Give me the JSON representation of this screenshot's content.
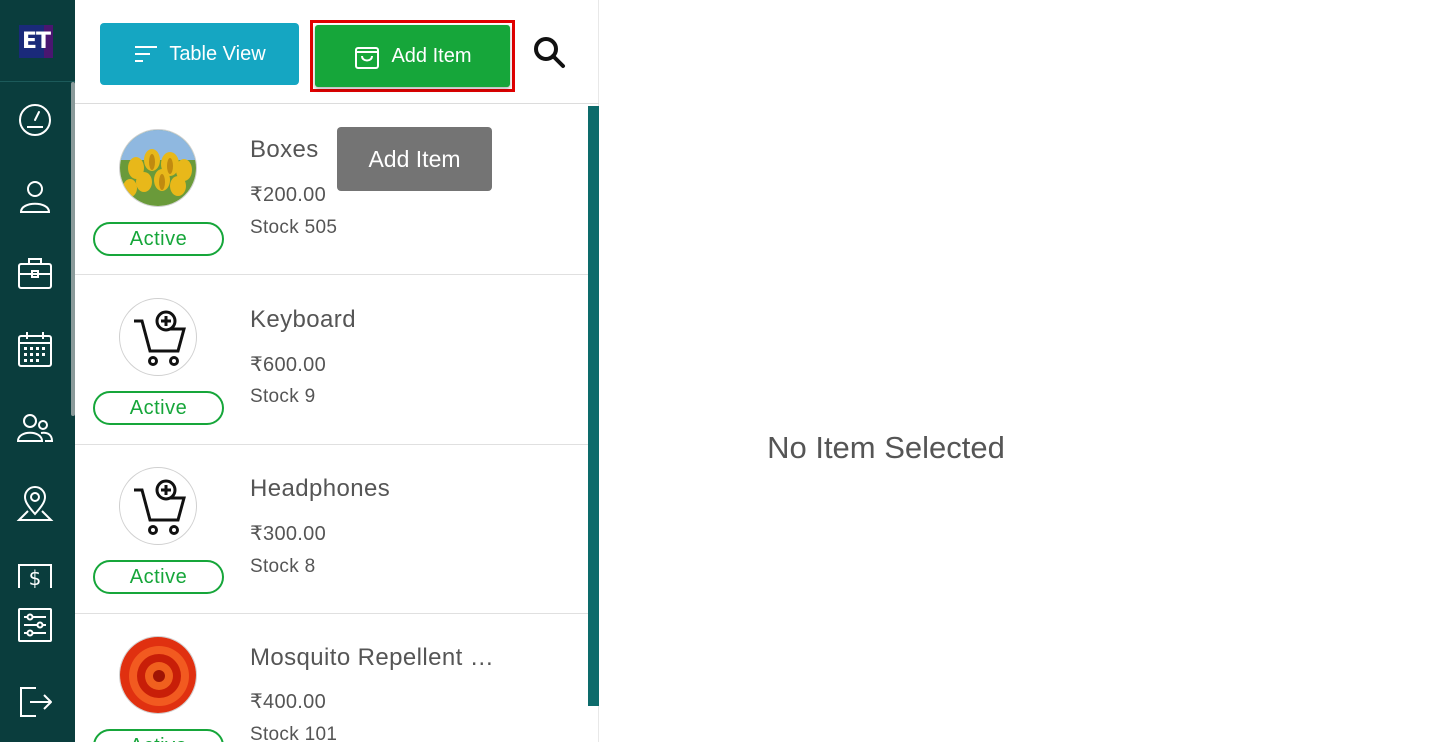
{
  "sidebar": {
    "logo_text": "ET",
    "items": [
      {
        "icon": "dashboard-gauge-icon"
      },
      {
        "icon": "user-icon"
      },
      {
        "icon": "briefcase-icon"
      },
      {
        "icon": "calendar-icon"
      },
      {
        "icon": "users-icon"
      },
      {
        "icon": "map-pin-icon"
      },
      {
        "icon": "dollar-icon"
      },
      {
        "icon": "settings-sliders-icon"
      },
      {
        "icon": "logout-icon"
      }
    ]
  },
  "toolbar": {
    "table_view_label": "Table View",
    "add_item_label": "Add Item"
  },
  "tooltip": "Add Item",
  "items": [
    {
      "name": "Boxes",
      "price": "₹200.00",
      "stock": "Stock 505",
      "status": "Active",
      "image": "yellow-tulips"
    },
    {
      "name": "Keyboard",
      "price": "₹600.00",
      "stock": "Stock 9",
      "status": "Active",
      "image": "cart-placeholder"
    },
    {
      "name": "Headphones",
      "price": "₹300.00",
      "stock": "Stock 8",
      "status": "Active",
      "image": "cart-placeholder"
    },
    {
      "name": "Mosquito Repellent …",
      "price": "₹400.00",
      "stock": "Stock 101",
      "status": "Active",
      "image": "red-flower"
    }
  ],
  "detail": {
    "empty_message": "No Item Selected"
  },
  "colors": {
    "sidebar": "#0a3d3d",
    "table_view_button": "#15a6c2",
    "add_item_button": "#16a63a",
    "highlight_border": "#e00000",
    "active_status": "#16a63a"
  }
}
